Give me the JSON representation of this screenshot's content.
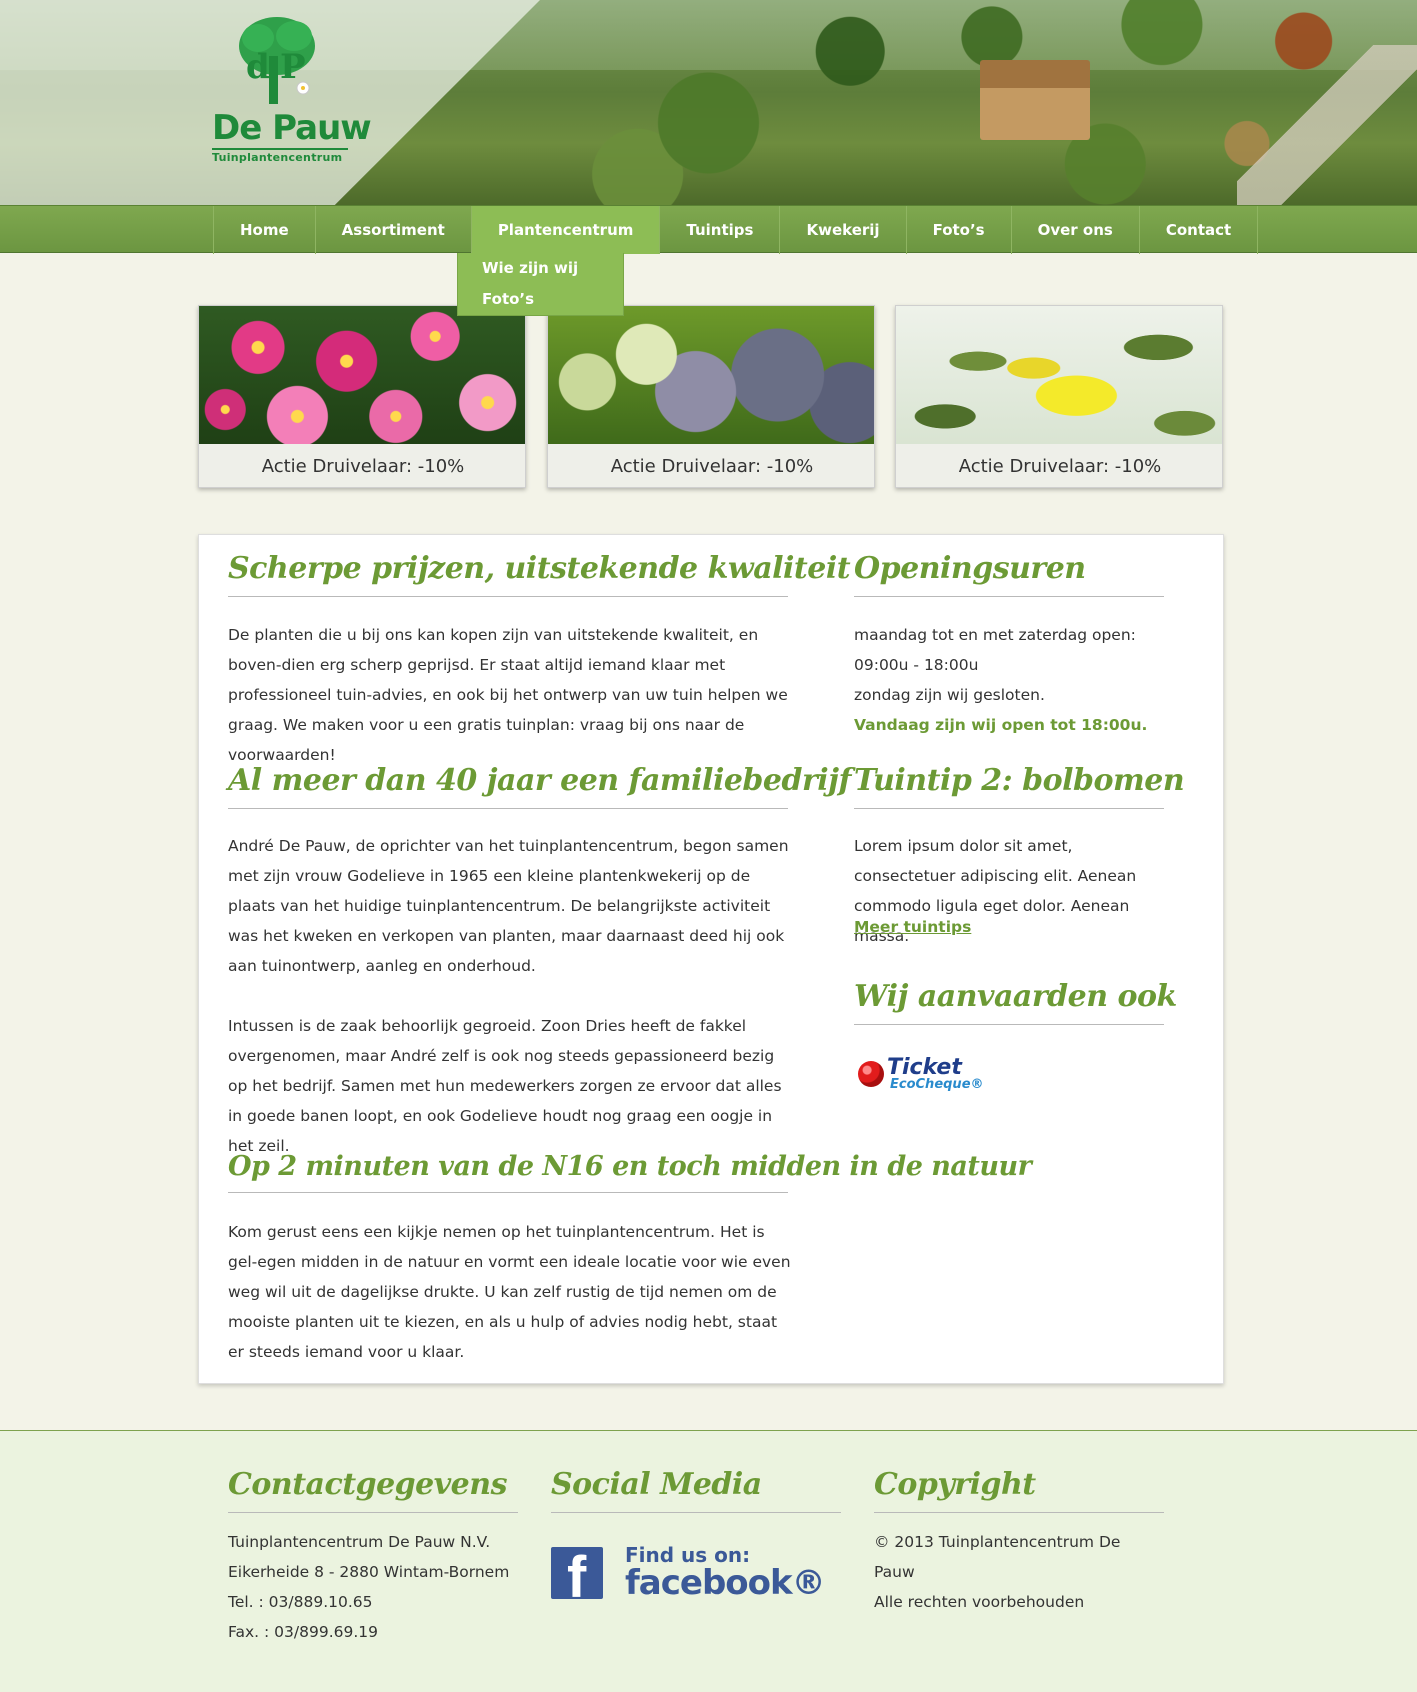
{
  "brand": {
    "name": "De Pauw",
    "subtitle": "Tuinplantencentrum"
  },
  "nav": {
    "items": [
      "Home",
      "Assortiment",
      "Plantencentrum",
      "Tuintips",
      "Kwekerij",
      "Foto’s",
      "Over ons",
      "Contact"
    ],
    "active": "Plantencentrum",
    "dropdown": [
      "Wie zijn wij",
      "Foto’s"
    ]
  },
  "cards": [
    {
      "caption": "Actie Druivelaar: -10%"
    },
    {
      "caption": "Actie Druivelaar: -10%"
    },
    {
      "caption": "Actie Druivelaar: -10%"
    }
  ],
  "content": {
    "h1": "Scherpe prijzen, uitstekende kwaliteit",
    "p1": "De planten die u bij ons kan kopen zijn van uitstekende kwaliteit, en boven-dien erg scherp geprijsd. Er staat altijd iemand klaar met professioneel tuin-advies, en ook bij het ontwerp van uw tuin helpen we graag. We maken voor u een gratis tuinplan: vraag bij ons naar de voorwaarden!",
    "h2": "Al meer dan 40 jaar een familiebedrijf",
    "p2": "André De Pauw, de oprichter van het tuinplantencentrum, begon samen met zijn vrouw Godelieve in 1965 een kleine plantenkwekerij op de plaats van het huidige tuinplantencentrum. De belangrijkste activiteit was het kweken en verkopen van planten, maar daarnaast deed hij ook aan tuinontwerp, aanleg en onderhoud.",
    "p3": "Intussen is de zaak behoorlijk gegroeid. Zoon Dries heeft de fakkel overgenomen, maar André zelf is ook nog steeds gepassioneerd bezig op het bedrijf. Samen met hun medewerkers zorgen ze ervoor dat alles in goede banen loopt, en ook Godelieve houdt nog graag een oogje in het zeil.",
    "h3": "Op 2 minuten van de N16 en toch midden in de natuur",
    "p4": "Kom gerust eens een kijkje nemen op het tuinplantencentrum. Het is gel-egen midden in de natuur en vormt een ideale locatie voor wie even weg wil uit de dagelijkse drukte. U kan zelf rustig de tijd nemen om de mooiste planten uit te kiezen, en als u hulp of advies nodig hebt, staat er steeds iemand voor u klaar."
  },
  "sidebar": {
    "hours_title": "Openingsuren",
    "hours_line1": "maandag tot en met zaterdag open:",
    "hours_line2": "09:00u - 18:00u",
    "hours_line3": "zondag zijn wij gesloten.",
    "today": "Vandaag zijn wij open tot 18:00u.",
    "tip_title": "Tuintip 2: bolbomen",
    "tip_text": "Lorem ipsum dolor sit amet, consectetuer adipiscing elit. Aenean commodo ligula eget dolor. Aenean massa.",
    "tip_link": "Meer tuintips",
    "accept_title": "Wij aanvaarden ook",
    "ticket_brand": "Ticket",
    "ticket_product": "EcoCheque®"
  },
  "footer": {
    "contact_title": "Contactgegevens",
    "contact_lines": [
      "Tuinplantencentrum De Pauw N.V.",
      "Eikerheide 8 - 2880 Wintam-Bornem",
      "Tel. : 03/889.10.65",
      "Fax. : 03/899.69.19"
    ],
    "social_title": "Social Media",
    "fb_find": "Find us on:",
    "fb_word": "facebook®",
    "copyright_title": "Copyright",
    "copyright_lines": [
      "© 2013 Tuinplantencentrum De Pauw",
      "Alle rechten voorbehouden"
    ]
  },
  "colors": {
    "accent": "#6c9a35",
    "nav": "#7fa84f",
    "nav_active": "#8dbd55",
    "footer_bg": "#ebf3df",
    "facebook": "#3b5998"
  }
}
